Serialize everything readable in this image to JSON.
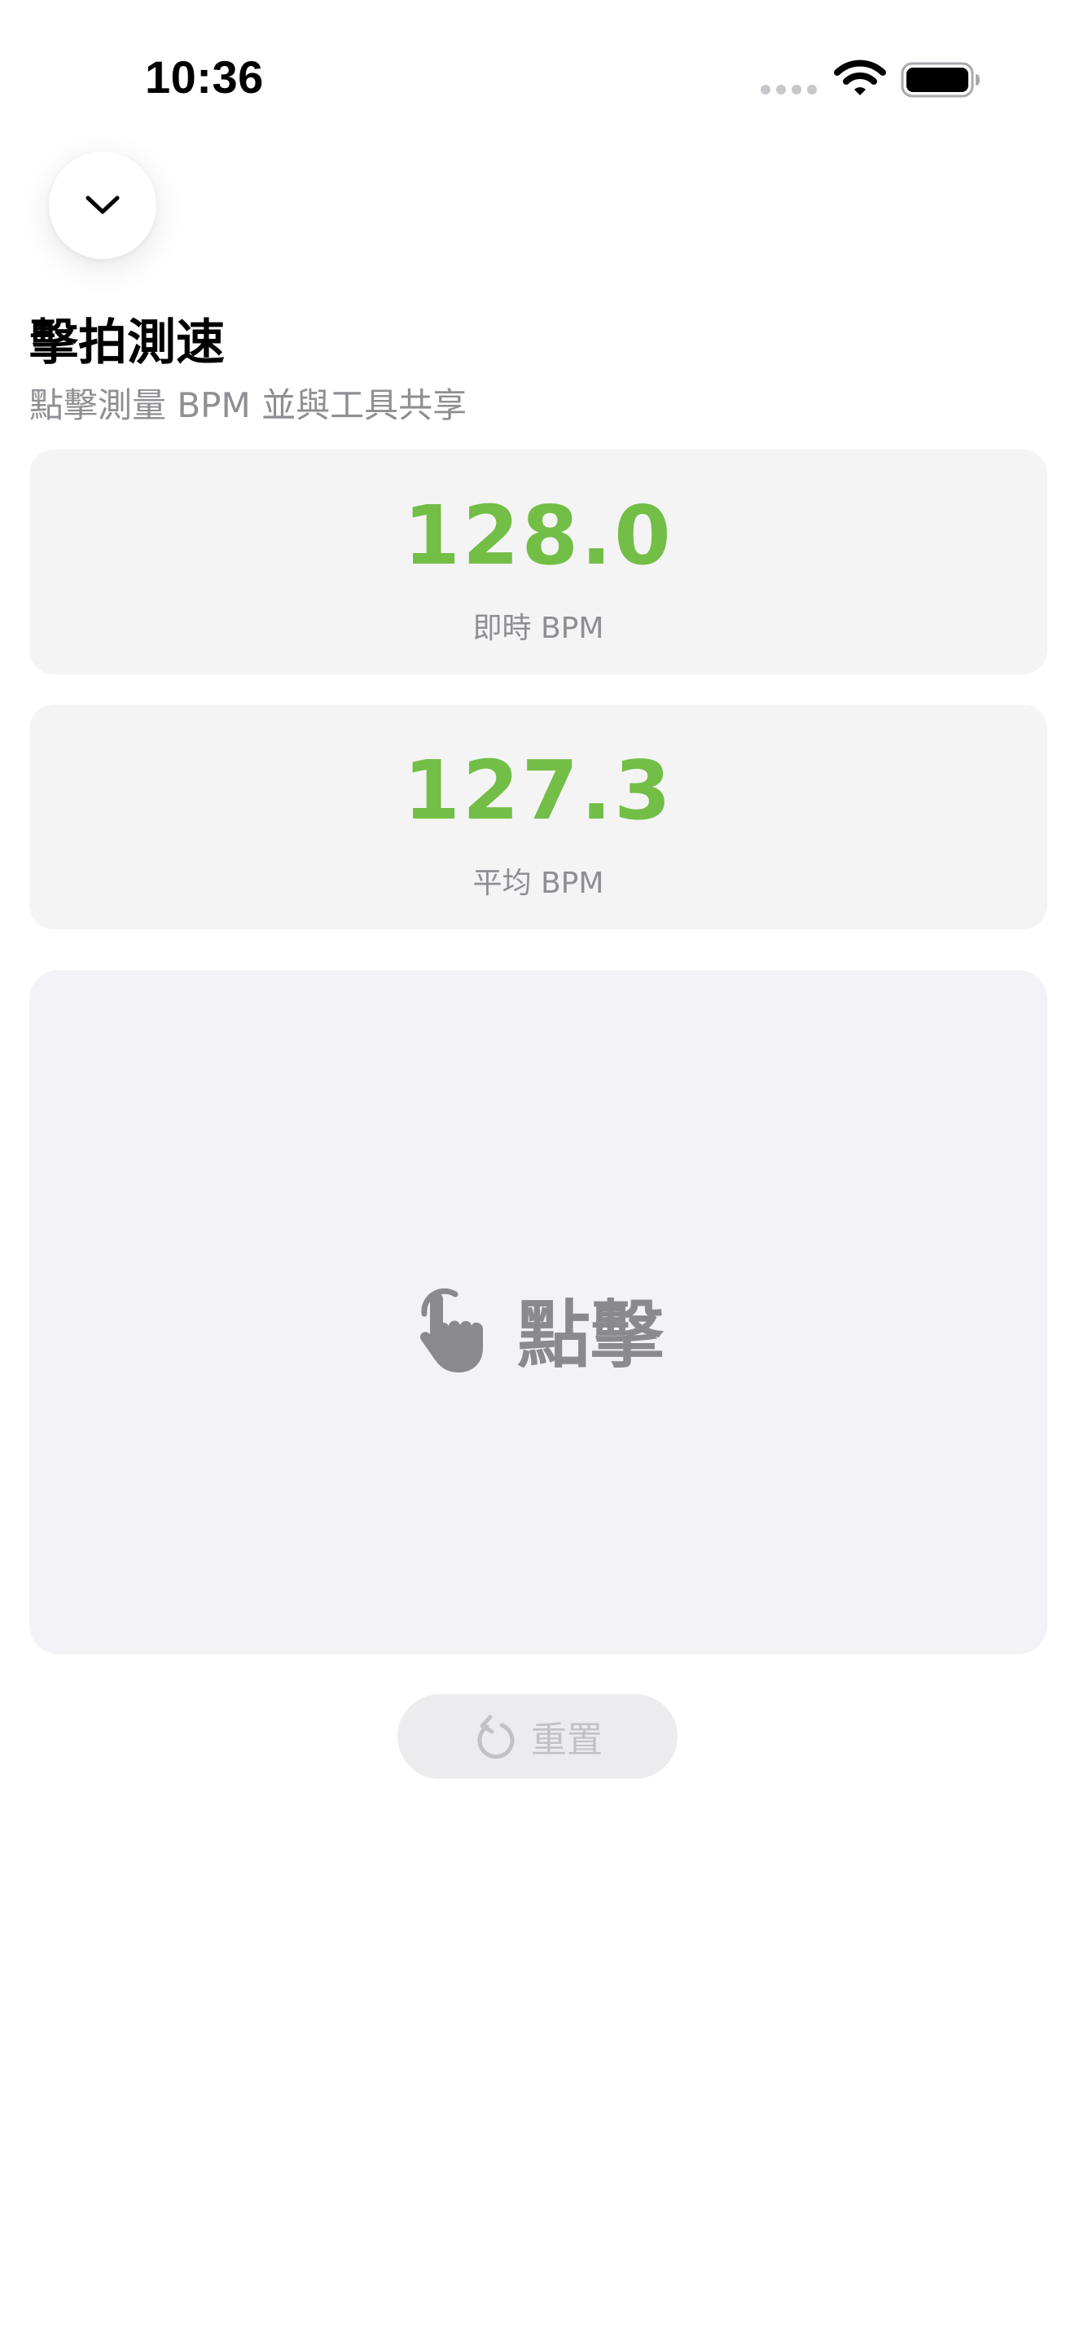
{
  "status_bar": {
    "time": "10:36",
    "icons": [
      "cellular-signal-icon",
      "wifi-icon",
      "battery-icon"
    ]
  },
  "collapse_button": {
    "icon": "chevron-down-icon"
  },
  "header": {
    "title": "擊拍測速",
    "subtitle": "點擊測量 BPM 並與工具共享"
  },
  "instant_card": {
    "value": "128.0",
    "label": "即時 BPM"
  },
  "average_card": {
    "value": "127.3",
    "label": "平均 BPM"
  },
  "tap_area": {
    "icon": "hand-tap-icon",
    "label": "點擊"
  },
  "reset_button": {
    "icon": "counterclockwise-arrow-icon",
    "label": "重置"
  },
  "colors": {
    "accent_green": "#72be46",
    "card_background": "#f4f4f5",
    "tap_background": "#f2f2f7",
    "secondary_text": "#8e8e93"
  }
}
